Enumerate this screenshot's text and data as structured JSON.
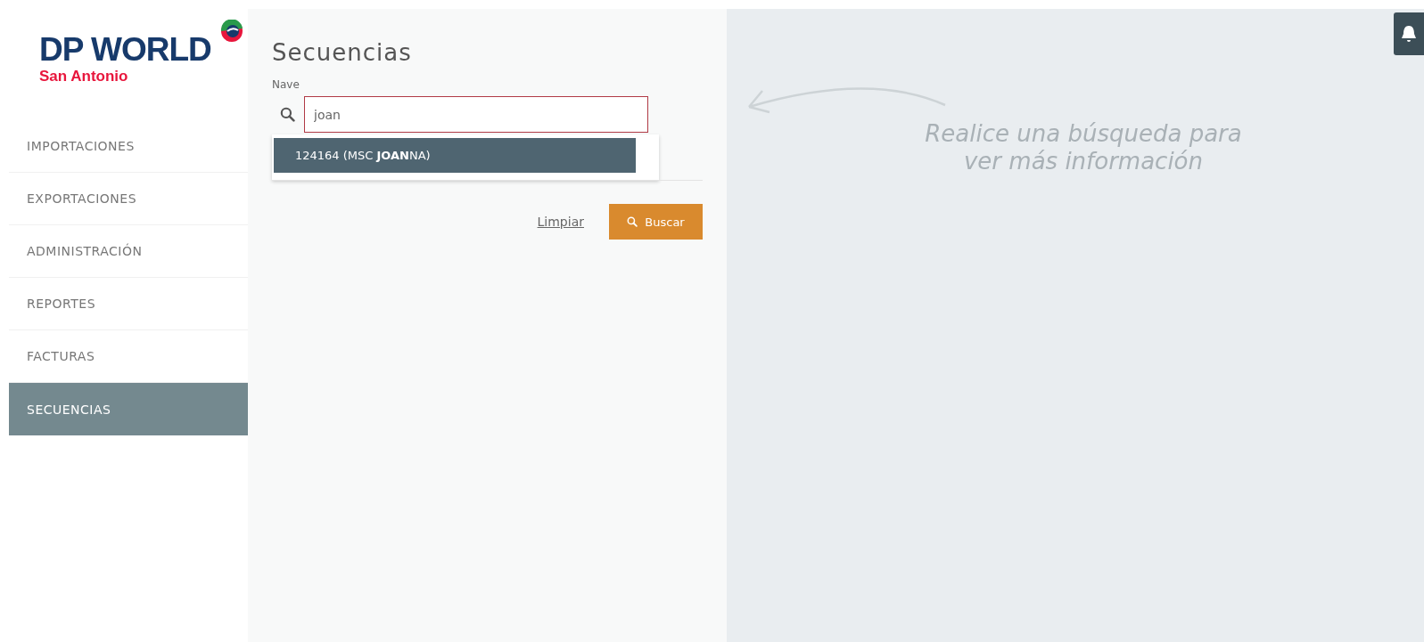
{
  "logo": {
    "brand": "DP WORLD",
    "location": "San Antonio"
  },
  "nav": [
    {
      "label": "IMPORTACIONES",
      "selected": false
    },
    {
      "label": "EXPORTACIONES",
      "selected": false
    },
    {
      "label": "ADMINISTRACIÓN",
      "selected": false
    },
    {
      "label": "REPORTES",
      "selected": false
    },
    {
      "label": "FACTURAS",
      "selected": false
    },
    {
      "label": "SECUENCIAS",
      "selected": true
    }
  ],
  "form": {
    "title": "Secuencias",
    "field_label": "Nave",
    "value": "joan",
    "suggestions": [
      {
        "label": "124164 (MSC **JOAN**NA)",
        "selected": true
      }
    ],
    "clear_link": "Limpiar",
    "search_button": "Buscar"
  },
  "hint": "Realice una búsqueda para\nver más información"
}
